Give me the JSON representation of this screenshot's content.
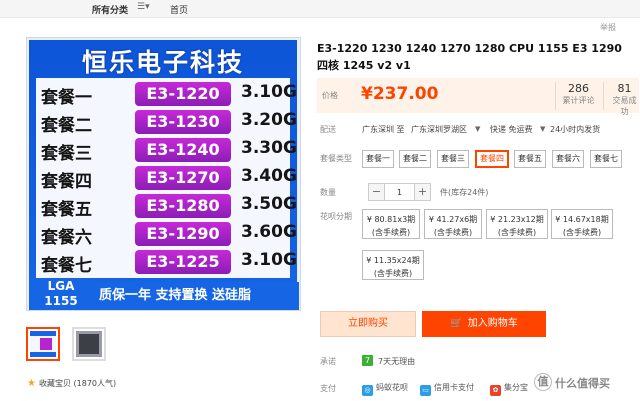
{
  "nav": {
    "all_categories": "所有分类",
    "home": "首页",
    "menu_icon": "list-icon"
  },
  "report": "举报",
  "product_image": {
    "shop_name": "恒乐电子科技",
    "packages": [
      {
        "name": "套餐一",
        "cpu": "E3-1220",
        "freq": "3.10G"
      },
      {
        "name": "套餐二",
        "cpu": "E3-1230",
        "freq": "3.20G"
      },
      {
        "name": "套餐三",
        "cpu": "E3-1240",
        "freq": "3.30G"
      },
      {
        "name": "套餐四",
        "cpu": "E3-1270",
        "freq": "3.40G"
      },
      {
        "name": "套餐五",
        "cpu": "E3-1280",
        "freq": "3.50G"
      },
      {
        "name": "套餐六",
        "cpu": "E3-1290",
        "freq": "3.60G"
      },
      {
        "name": "套餐七",
        "cpu": "E3-1225",
        "freq": "3.10G"
      }
    ],
    "lga_line1": "LGA",
    "lga_line2": "1155",
    "promo": "质保一年 支持置换 送硅脂"
  },
  "favorite": {
    "label": "收藏宝贝",
    "count": "(1870人气)",
    "icon": "star-icon"
  },
  "title": "E3-1220 1230 1240 1270 1280 CPU 1155 E3 1290 四核 1245 v2 v1",
  "price": {
    "label": "价格",
    "value": "¥237.00",
    "reviews_count": "286",
    "reviews_label": "累计评论",
    "trades_count": "81",
    "trades_label": "交易成功"
  },
  "shipping": {
    "label": "配送",
    "from": "广东深圳 至",
    "to": "广东深圳罗湖区",
    "method": "快递 免运费",
    "time": "24小时内发货"
  },
  "package": {
    "label": "套餐类型",
    "options": [
      "套餐一",
      "套餐二",
      "套餐三",
      "套餐四",
      "套餐五",
      "套餐六",
      "套餐七"
    ],
    "selected": "套餐四"
  },
  "quantity": {
    "label": "数量",
    "value": "1",
    "minus": "−",
    "plus": "+",
    "stock": "件(库存24件)"
  },
  "installments": {
    "label": "花呗分期",
    "options": [
      {
        "amount": "¥ 80.81x3期",
        "fee": "(含手续费)"
      },
      {
        "amount": "¥ 41.27x6期",
        "fee": "(含手续费)"
      },
      {
        "amount": "¥ 21.23x12期",
        "fee": "(含手续费)"
      },
      {
        "amount": "¥ 14.67x18期",
        "fee": "(含手续费)"
      },
      {
        "amount": "¥ 11.35x24期",
        "fee": "(含手续费)"
      }
    ]
  },
  "actions": {
    "buy_now": "立即购买",
    "add_cart": "加入购物车"
  },
  "promise": {
    "label": "承诺",
    "icon_text": "7",
    "text": "7天无理由"
  },
  "payment": {
    "label": "支付",
    "methods": [
      "蚂蚁花呗",
      "信用卡支付",
      "集分宝"
    ]
  },
  "watermark": {
    "icon": "值",
    "text": "什么值得买"
  },
  "colors": {
    "accent": "#ff4400",
    "image_blue": "#1565e4",
    "cpu_purple": "#b524cf"
  }
}
